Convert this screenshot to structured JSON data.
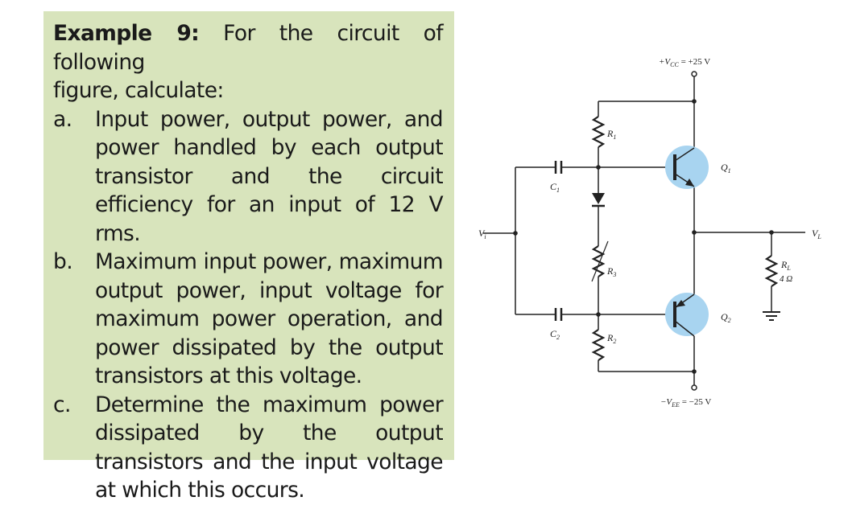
{
  "problem": {
    "heading_bold": "Example 9:",
    "heading_rest": " For the circuit of following",
    "heading_line2": "figure, calculate:",
    "items": [
      {
        "marker": "a.",
        "text": "Input power, output power, and power handled by each output transistor and the circuit efficiency for an input of 12 V rms."
      },
      {
        "marker": "b.",
        "text": "Maximum input power, maximum output power, input voltage for maximum power operation, and power dissipated by the output transistors at this voltage."
      },
      {
        "marker": "c.",
        "text": "Determine the maximum power dissipated by the output transistors and the input voltage at which this occurs."
      }
    ],
    "box_color": "#d8e4bc"
  },
  "circuit": {
    "vcc_label": "+V",
    "vcc_sub": "CC",
    "vcc_value": " = +25 V",
    "vee_label": "−V",
    "vee_sub": "EE",
    "vee_value": " = −25 V",
    "vi_label": "V",
    "vi_sub": "i",
    "vl_label": "V",
    "vl_sub": "L",
    "r1": {
      "name": "R",
      "sub": "1"
    },
    "r2": {
      "name": "R",
      "sub": "2"
    },
    "r3": {
      "name": "R",
      "sub": "3"
    },
    "rl": {
      "name": "R",
      "sub": "L",
      "value": "4 Ω"
    },
    "c1": {
      "name": "C",
      "sub": "1"
    },
    "c2": {
      "name": "C",
      "sub": "2"
    },
    "q1": {
      "name": "Q",
      "sub": "1"
    },
    "q2": {
      "name": "Q",
      "sub": "2"
    },
    "transistor_highlight": "#a8d4f0"
  }
}
